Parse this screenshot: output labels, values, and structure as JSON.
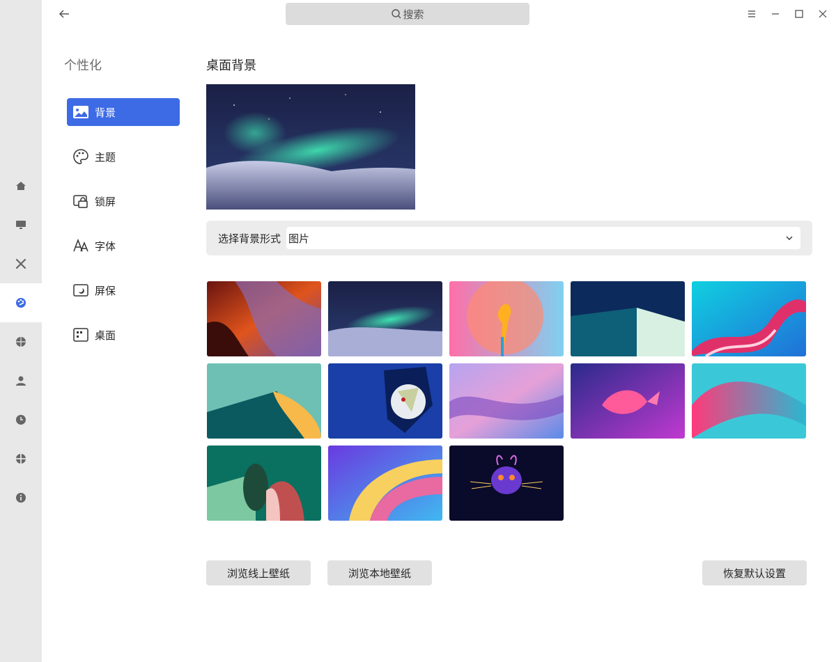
{
  "search": {
    "placeholder": "搜索"
  },
  "rail": {
    "items": [
      {
        "icon": "home-icon"
      },
      {
        "icon": "monitor-icon"
      },
      {
        "icon": "tools-icon"
      },
      {
        "icon": "palette-icon",
        "active": true
      },
      {
        "icon": "globe-icon"
      },
      {
        "icon": "user-icon"
      },
      {
        "icon": "clock-icon"
      },
      {
        "icon": "network-icon"
      },
      {
        "icon": "info-icon"
      }
    ]
  },
  "nav": {
    "title": "个性化",
    "items": [
      {
        "label": "背景",
        "icon": "image-icon",
        "active": true
      },
      {
        "label": "主题",
        "icon": "palette-icon"
      },
      {
        "label": "锁屏",
        "icon": "lockscreen-icon"
      },
      {
        "label": "字体",
        "icon": "font-icon"
      },
      {
        "label": "屏保",
        "icon": "screensaver-icon"
      },
      {
        "label": "桌面",
        "icon": "desktop-icon"
      }
    ]
  },
  "main": {
    "title": "桌面背景",
    "background_form": {
      "label": "选择背景形式",
      "value": "图片"
    },
    "wallpapers": [
      "red-canyon",
      "aurora-night",
      "pink-flower",
      "navy-teal-shapes",
      "cyan-ribbon",
      "teal-yellow-curve",
      "blue-dragon-art",
      "purple-waves",
      "purple-goldfish",
      "pink-teal-wave",
      "green-paper-fold",
      "rainbow-swirl",
      "neon-tiger"
    ],
    "buttons": {
      "online": "浏览线上壁纸",
      "local": "浏览本地壁纸",
      "reset": "恢复默认设置"
    }
  },
  "colors": {
    "accent": "#3d6be5",
    "rail_bg": "#e8e8e8"
  }
}
